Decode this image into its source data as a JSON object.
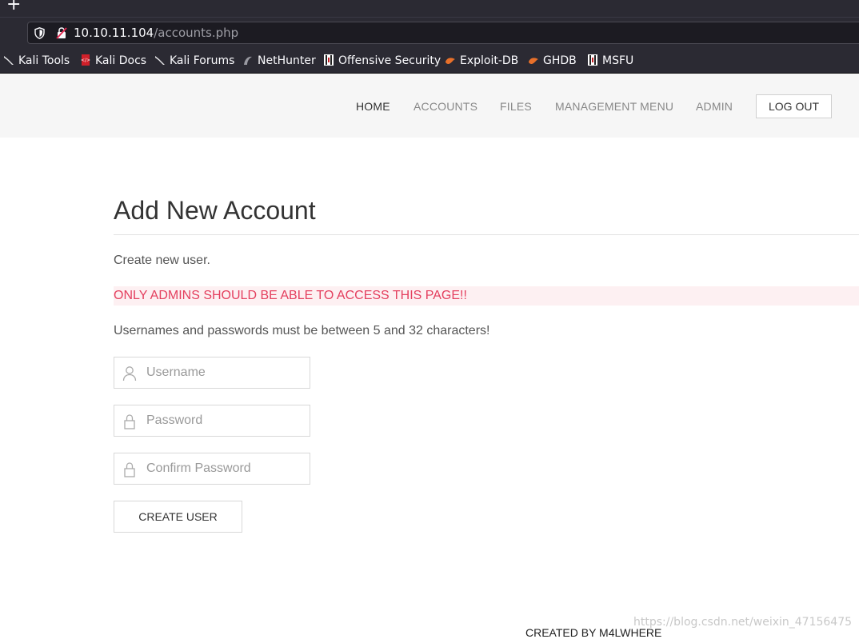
{
  "browser": {
    "new_tab_glyph": "+",
    "url_host": "10.10.11.104",
    "url_path": "/accounts.php",
    "bookmarks": [
      {
        "label": "Kali Tools",
        "icon": "kali-dragon-icon"
      },
      {
        "label": "Kali Docs",
        "icon": "kali-docs-icon"
      },
      {
        "label": "Kali Forums",
        "icon": "kali-dragon-icon"
      },
      {
        "label": "NetHunter",
        "icon": "nethunter-icon"
      },
      {
        "label": "Offensive Security",
        "icon": "offsec-icon"
      },
      {
        "label": "Exploit-DB",
        "icon": "exploitdb-icon"
      },
      {
        "label": "GHDB",
        "icon": "exploitdb-icon"
      },
      {
        "label": "MSFU",
        "icon": "offsec-icon"
      }
    ]
  },
  "nav": {
    "items": [
      "HOME",
      "ACCOUNTS",
      "FILES",
      "MANAGEMENT MENU",
      "ADMIN"
    ],
    "logout_label": "LOG OUT"
  },
  "main": {
    "title": "Add New Account",
    "intro": "Create new user.",
    "warning": "ONLY ADMINS SHOULD BE ABLE TO ACCESS THIS PAGE!!",
    "rules": "Usernames and passwords must be between 5 and 32 characters!",
    "fields": {
      "username_placeholder": "Username",
      "password_placeholder": "Password",
      "confirm_placeholder": "Confirm Password"
    },
    "create_label": "CREATE USER"
  },
  "footer": {
    "credit": "CREATED BY M4LWHERE"
  },
  "watermark": "https://blog.csdn.net/weixin_47156475",
  "colors": {
    "warning_text": "#e4405f",
    "warning_bg": "#fdf0f2",
    "header_bg": "#f6f6f6",
    "browser_chrome": "#2b2a33"
  }
}
